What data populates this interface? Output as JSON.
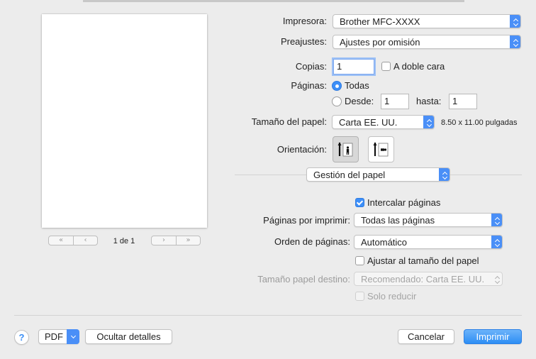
{
  "preview": {
    "first_icon": "«",
    "prev_icon": "‹",
    "page_indicator": "1 de 1",
    "next_icon": "›",
    "last_icon": "»"
  },
  "printer": {
    "label": "Impresora:",
    "value": "Brother MFC-XXXX"
  },
  "presets": {
    "label": "Preajustes:",
    "value": "Ajustes por omisión"
  },
  "copies": {
    "label": "Copias:",
    "value": "1",
    "duplex_label": "A doble cara"
  },
  "pages": {
    "label": "Páginas:",
    "all_label": "Todas",
    "from_label": "Desde:",
    "from_value": "1",
    "to_label": "hasta:",
    "to_value": "1"
  },
  "paper_size": {
    "label": "Tamaño del papel:",
    "value": "Carta EE. UU.",
    "dimensions": "8.50 x 11.00 pulgadas"
  },
  "orientation": {
    "label": "Orientación:",
    "selected": "portrait"
  },
  "section": {
    "value": "Gestión del papel"
  },
  "paper_handling": {
    "collate_label": "Intercalar páginas",
    "collate_checked": true,
    "pages_to_print_label": "Páginas por imprimir:",
    "pages_to_print_value": "Todas las páginas",
    "page_order_label": "Orden de páginas:",
    "page_order_value": "Automático",
    "scale_to_fit_label": "Ajustar al tamaño del papel",
    "scale_to_fit_checked": false,
    "dest_paper_label": "Tamaño papel destino:",
    "dest_paper_value": "Recomendado: Carta EE. UU.",
    "scale_down_only_label": "Solo reducir"
  },
  "footer": {
    "help_label": "?",
    "pdf_label": "PDF",
    "hide_details_label": "Ocultar detalles",
    "cancel_label": "Cancelar",
    "print_label": "Imprimir"
  },
  "colors": {
    "accent": "#3d8ff8",
    "background": "#ececec"
  }
}
